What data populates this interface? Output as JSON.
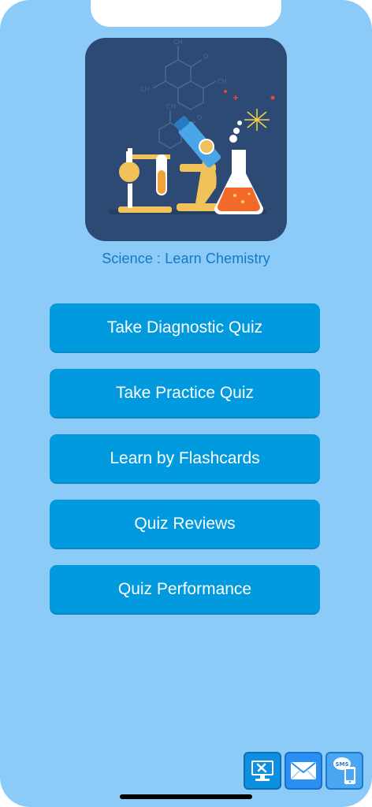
{
  "app": {
    "title": "Science : Learn Chemistry"
  },
  "menu": [
    {
      "label": "Take Diagnostic Quiz"
    },
    {
      "label": "Take Practice Quiz"
    },
    {
      "label": "Learn by Flashcards"
    },
    {
      "label": "Quiz Reviews"
    },
    {
      "label": "Quiz Performance"
    }
  ],
  "dock": [
    {
      "icon": "support-tools-icon"
    },
    {
      "icon": "mail-icon"
    },
    {
      "icon": "sms-icon",
      "label": "SMS"
    }
  ],
  "colors": {
    "background": "#8ccaf7",
    "button": "#019ade",
    "title": "#1478c8",
    "icon_bg": "#2d4a74"
  }
}
